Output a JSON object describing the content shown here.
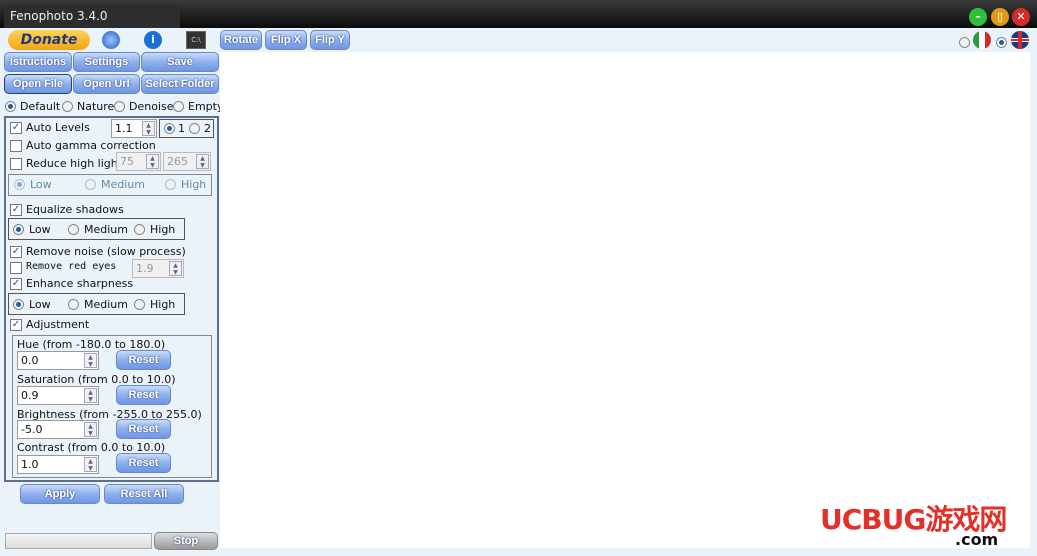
{
  "window": {
    "title": "Fenophoto 3.4.0"
  },
  "toolbar": {
    "donate": "Donate",
    "rotate": "Rotate",
    "flip_x": "Flip X",
    "flip_y": "Flip Y"
  },
  "buttons": {
    "instructions": "Istructions",
    "settings": "Settings",
    "save": "Save",
    "open_file": "Open File",
    "open_url": "Open Url",
    "select_folder": "Select Folder",
    "apply": "Apply",
    "reset_all": "Reset All",
    "stop": "Stop",
    "reset": "Reset"
  },
  "presets": {
    "options": [
      "Default",
      "Nature",
      "Denoise",
      "Empty"
    ],
    "selected": "Default"
  },
  "auto_levels": {
    "label": "Auto Levels",
    "checked": true,
    "value": "1.1",
    "opt1": "1",
    "opt2": "2"
  },
  "auto_gamma": {
    "label": "Auto gamma correction",
    "checked": false
  },
  "reduce_highlight": {
    "label": "Reduce high light",
    "checked": false,
    "v1": "75",
    "v2": "265",
    "levels": [
      "Low",
      "Medium",
      "High"
    ]
  },
  "equalize_shadows": {
    "label": "Equalize shadows",
    "checked": true,
    "levels": [
      "Low",
      "Medium",
      "High"
    ]
  },
  "remove_noise": {
    "label": "Remove noise (slow process)",
    "checked": true
  },
  "remove_red_eyes": {
    "label": "Remove red eyes",
    "checked": false,
    "value": "1.9"
  },
  "enhance_sharpness": {
    "label": "Enhance sharpness",
    "checked": true,
    "levels": [
      "Low",
      "Medium",
      "High"
    ]
  },
  "adjustment": {
    "label": "Adjustment",
    "checked": true,
    "hue": {
      "label": "Hue (from -180.0 to 180.0)",
      "value": "0.0"
    },
    "saturation": {
      "label": "Saturation (from 0.0 to 10.0)",
      "value": "0.9"
    },
    "brightness": {
      "label": "Brightness (from -255.0 to 255.0)",
      "value": "-5.0"
    },
    "contrast": {
      "label": "Contrast (from 0.0 to 10.0)",
      "value": "1.0"
    }
  },
  "progress": {
    "value": 0
  },
  "language": {
    "selected": "english"
  },
  "watermark": {
    "text": "UCBUG游戏网",
    "sub": ".com"
  }
}
